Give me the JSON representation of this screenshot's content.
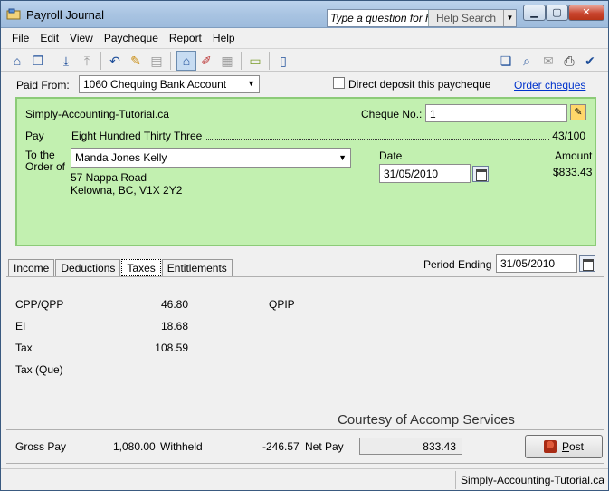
{
  "window": {
    "title": "Payroll Journal",
    "help_placeholder": "Type a question for help",
    "help_search_label": "Help Search",
    "minimize_icon": "minimize-icon",
    "maximize_icon": "maximize-icon",
    "close_icon": "close-icon"
  },
  "menu": {
    "items": [
      "File",
      "Edit",
      "View",
      "Paycheque",
      "Report",
      "Help"
    ]
  },
  "toolbar": {
    "icons": [
      "home-icon",
      "restore-window-icon",
      "save-icon",
      "upload-icon",
      "undo-icon",
      "tag-icon",
      "lookup-icon",
      "journal-icon",
      "track-icon",
      "calculator-icon",
      "recall-icon",
      "device-icon",
      "copy-icon",
      "search-icon",
      "email-icon",
      "print-icon",
      "check-icon"
    ]
  },
  "paid_from": {
    "label": "Paid From:",
    "value": "1060 Chequing Bank Account"
  },
  "direct_deposit": {
    "label": "Direct deposit this paycheque",
    "checked": false
  },
  "order_cheques_link": "Order cheques",
  "cheque": {
    "company": "Simply-Accounting-Tutorial.ca",
    "cheque_no_label": "Cheque No.:",
    "cheque_no": "1",
    "pay_label": "Pay",
    "pay_words": "Eight Hundred Thirty Three",
    "pay_cents": "43/100",
    "order_label_line1": "To the",
    "order_label_line2": "Order of",
    "payee": "Manda Jones Kelly",
    "address_line1": "57 Nappa Road",
    "address_line2": "Kelowna, BC, V1X 2Y2",
    "date_label": "Date",
    "date": "31/05/2010",
    "amount_label": "Amount",
    "amount": "$833.43"
  },
  "tabs": [
    "Income",
    "Deductions",
    "Taxes",
    "Entitlements"
  ],
  "active_tab": "Taxes",
  "period_ending": {
    "label": "Period Ending",
    "value": "31/05/2010"
  },
  "taxes": [
    {
      "label": "CPP/QPP",
      "value": "46.80"
    },
    {
      "label": "EI",
      "value": "18.68"
    },
    {
      "label": "Tax",
      "value": "108.59"
    },
    {
      "label": "Tax (Que)",
      "value": ""
    }
  ],
  "qpip_label": "QPIP",
  "watermark": "Courtesy of Accomp Services",
  "totals": {
    "gross_label": "Gross Pay",
    "gross_value": "1,080.00",
    "withheld_label": "Withheld",
    "withheld_value": "-246.57",
    "net_label": "Net Pay",
    "net_value": "833.43"
  },
  "post_button": {
    "label_underlined": "P",
    "label_rest": "ost"
  },
  "status": {
    "text": "Simply-Accounting-Tutorial.ca"
  }
}
